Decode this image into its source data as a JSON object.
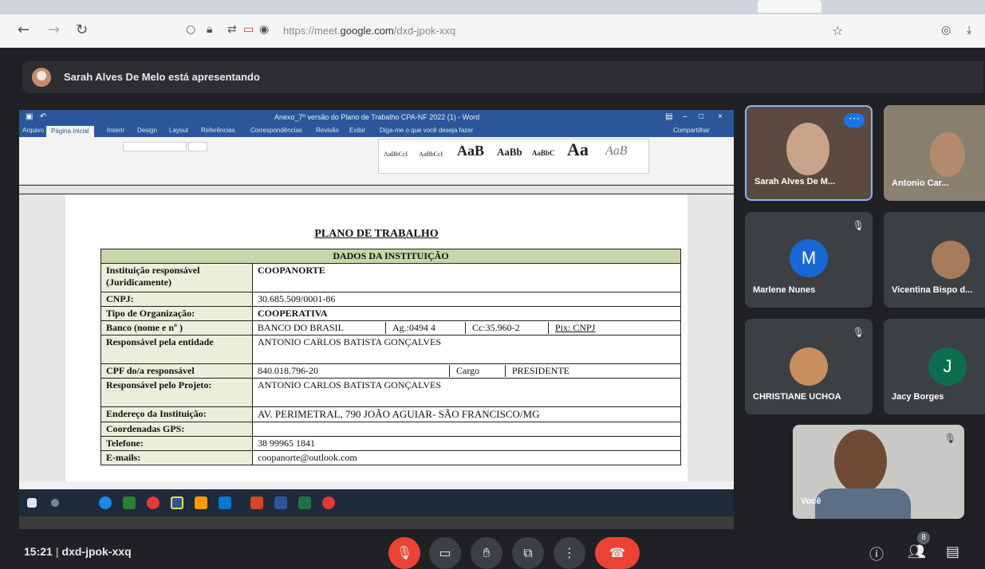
{
  "browser": {
    "url_prefix": "https://meet.",
    "url_domain": "google.com",
    "url_path": "/dxd-jpok-xxq",
    "icons": [
      "back-icon",
      "forward-icon",
      "reload-icon",
      "shield-icon",
      "lock-icon",
      "bookmark-star-icon",
      "pocket-icon",
      "download-icon"
    ]
  },
  "meet": {
    "presenter_banner": "Sarah Alves De Melo está apresentando",
    "time": "15:21",
    "separator": "|",
    "meeting_code": "dxd-jpok-xxq",
    "participants_count": "8"
  },
  "word": {
    "title": "Anexo_7º versão do Plano de Trabalho CPA-NF 2022 (1) - Word",
    "menu": [
      "Arquivo",
      "Página Inicial",
      "Inserir",
      "Design",
      "Layout",
      "Referências",
      "Correspondências",
      "Revisão",
      "Exibir",
      "Diga-me o que você deseja fazer"
    ],
    "share_label": "Compartilhar",
    "style_samples": [
      "AaBbCcI",
      "AaBbCcI",
      "AaB",
      "AaBb",
      "AaBbC",
      "Aa",
      "AaB"
    ]
  },
  "document": {
    "title": "PLANO DE TRABALHO",
    "section_header": "DADOS DA INSTITUIÇÃO",
    "rows": [
      {
        "label": "Instituição responsável (Juridicamente)",
        "value": "COOPANORTE",
        "bold": true
      },
      {
        "label": "CNPJ:",
        "value": "30.685.509/0001-86"
      },
      {
        "label": "Tipo de Organização:",
        "value": "COOPERATIVA",
        "bold": true
      },
      {
        "label": "Banco (nome e nº )",
        "value": "BANCO DO BRASIL",
        "extra": [
          "Ag.:0494 4",
          "Cc:35.960-2",
          "Pix: CNPJ"
        ]
      },
      {
        "label": "Responsável pela entidade",
        "value": "ANTONIO CARLOS BATISTA GONÇALVES"
      },
      {
        "label": "CPF do/a responsável",
        "value": "840.018.796-20",
        "extra": [
          "Cargo",
          "PRESIDENTE"
        ]
      },
      {
        "label": "Responsável pelo Projeto:",
        "value": "ANTONIO CARLOS BATISTA GONÇALVES"
      },
      {
        "label": "Endereço da Instituição:",
        "value": "AV. PERIMETRAL, 790 JOÃO AGUIAR- SÃO FRANCISCO/MG"
      },
      {
        "label": "Coordenadas GPS:",
        "value": ""
      },
      {
        "label": "Telefone:",
        "value": "38 99965 1841"
      },
      {
        "label": "E-mails:",
        "value": "coopanorte@outlook.com"
      }
    ]
  },
  "participants": [
    {
      "name": "Sarah Alves De M...",
      "type": "video"
    },
    {
      "name": "Antonio Car...",
      "type": "video"
    },
    {
      "name": "Marlene Nunes",
      "type": "letter",
      "letter": "M",
      "color": "#1967d2"
    },
    {
      "name": "Vicentina Bispo d...",
      "type": "photo"
    },
    {
      "name": "CHRISTIANE UCHOA",
      "type": "photo"
    },
    {
      "name": "Jacy Borges",
      "type": "letter",
      "letter": "J",
      "color": "#0b6e4f"
    },
    {
      "name": "Você",
      "type": "video"
    }
  ],
  "colors": {
    "accent": "#1a73e8",
    "hangup": "#ea4335",
    "word_blue": "#2b579a"
  }
}
